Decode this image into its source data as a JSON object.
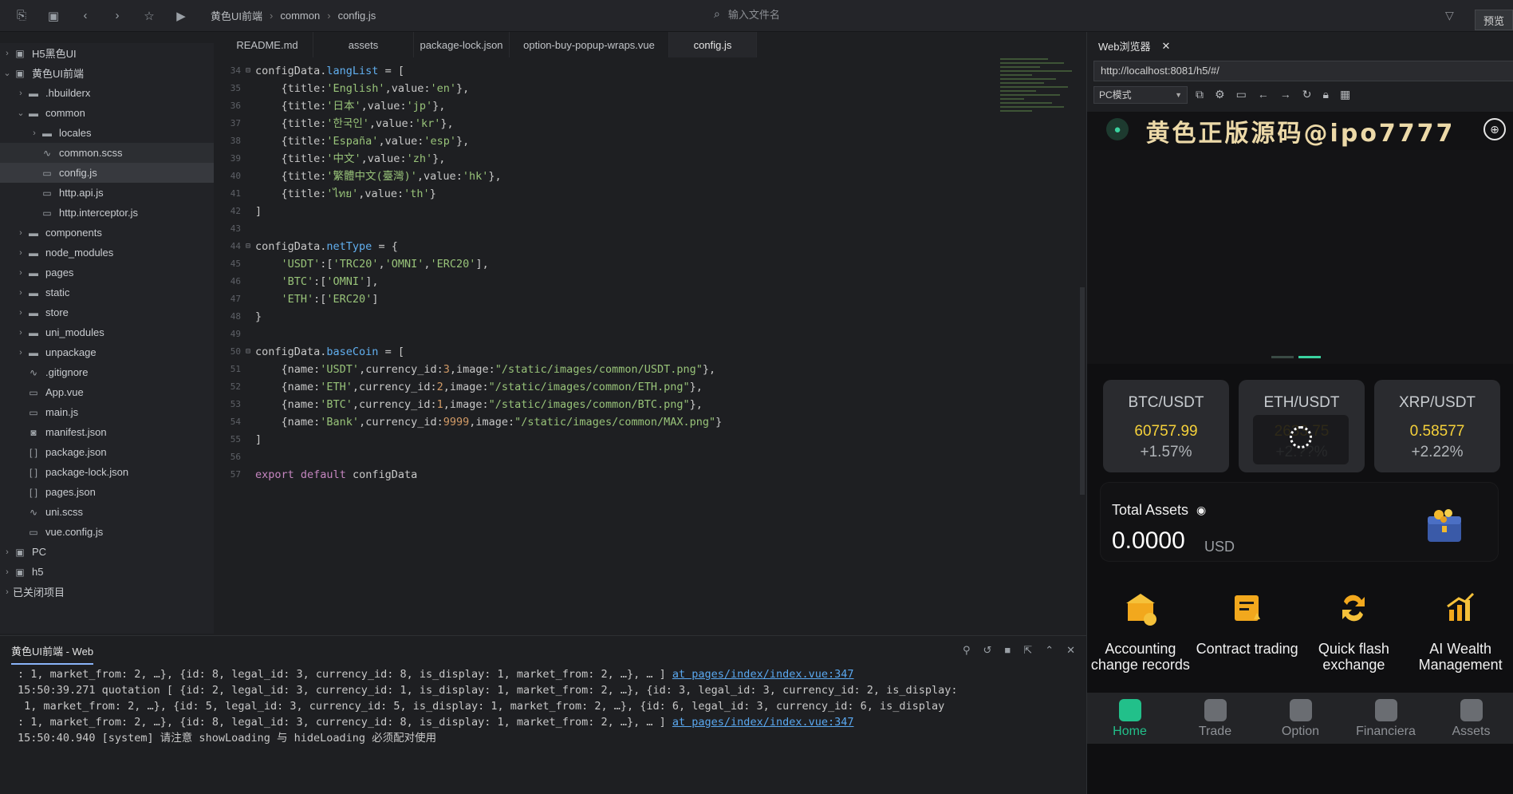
{
  "toolbar": {
    "breadcrumb": [
      "黄色UI前端",
      "common",
      "config.js"
    ],
    "file_search_placeholder": "输入文件名",
    "preview_label": "预览"
  },
  "sidebar": {
    "items": [
      {
        "label": "H5黑色UI",
        "depth": 0,
        "type": "project",
        "expanded": false
      },
      {
        "label": "黄色UI前端",
        "depth": 0,
        "type": "project",
        "expanded": true
      },
      {
        "label": ".hbuilderx",
        "depth": 1,
        "type": "folder",
        "expanded": false
      },
      {
        "label": "common",
        "depth": 1,
        "type": "folder",
        "expanded": true
      },
      {
        "label": "locales",
        "depth": 2,
        "type": "folder",
        "expanded": false
      },
      {
        "label": "common.scss",
        "depth": 2,
        "type": "style"
      },
      {
        "label": "config.js",
        "depth": 2,
        "type": "file"
      },
      {
        "label": "http.api.js",
        "depth": 2,
        "type": "file"
      },
      {
        "label": "http.interceptor.js",
        "depth": 2,
        "type": "file"
      },
      {
        "label": "components",
        "depth": 1,
        "type": "folder",
        "expanded": false
      },
      {
        "label": "node_modules",
        "depth": 1,
        "type": "folder",
        "expanded": false
      },
      {
        "label": "pages",
        "depth": 1,
        "type": "folder",
        "expanded": false
      },
      {
        "label": "static",
        "depth": 1,
        "type": "folder",
        "expanded": false
      },
      {
        "label": "store",
        "depth": 1,
        "type": "folder",
        "expanded": false
      },
      {
        "label": "uni_modules",
        "depth": 1,
        "type": "folder",
        "expanded": false
      },
      {
        "label": "unpackage",
        "depth": 1,
        "type": "folder",
        "expanded": false
      },
      {
        "label": ".gitignore",
        "depth": 1,
        "type": "style"
      },
      {
        "label": "App.vue",
        "depth": 1,
        "type": "file"
      },
      {
        "label": "main.js",
        "depth": 1,
        "type": "file"
      },
      {
        "label": "manifest.json",
        "depth": 1,
        "type": "manifest"
      },
      {
        "label": "package.json",
        "depth": 1,
        "type": "json"
      },
      {
        "label": "package-lock.json",
        "depth": 1,
        "type": "json"
      },
      {
        "label": "pages.json",
        "depth": 1,
        "type": "json"
      },
      {
        "label": "uni.scss",
        "depth": 1,
        "type": "style"
      },
      {
        "label": "vue.config.js",
        "depth": 1,
        "type": "file"
      },
      {
        "label": "PC",
        "depth": 0,
        "type": "project",
        "expanded": false
      },
      {
        "label": "h5",
        "depth": 0,
        "type": "project",
        "expanded": false
      },
      {
        "label": "已关闭项目",
        "depth": 0,
        "type": "group",
        "expanded": false
      }
    ]
  },
  "editor": {
    "tabs": [
      {
        "label": "README.md",
        "active": false
      },
      {
        "label": "assets",
        "active": false
      },
      {
        "label": "package-lock.json",
        "active": false
      },
      {
        "label": "option-buy-popup-wraps.vue",
        "active": false
      },
      {
        "label": "config.js",
        "active": true
      }
    ],
    "lines": [
      {
        "n": "34",
        "text": "configData.langList = [",
        "fold": true
      },
      {
        "n": "35",
        "text": "    {title:'English',value:'en'},"
      },
      {
        "n": "36",
        "text": "    {title:'日本',value:'jp'},"
      },
      {
        "n": "37",
        "text": "    {title:'한국인',value:'kr'},"
      },
      {
        "n": "38",
        "text": "    {title:'España',value:'esp'},"
      },
      {
        "n": "39",
        "text": "    {title:'中文',value:'zh'},"
      },
      {
        "n": "40",
        "text": "    {title:'繁體中文(臺灣)',value:'hk'},"
      },
      {
        "n": "41",
        "text": "    {title:'ไทย',value:'th'}"
      },
      {
        "n": "42",
        "text": "]"
      },
      {
        "n": "43",
        "text": ""
      },
      {
        "n": "44",
        "text": "configData.netType = {",
        "fold": true
      },
      {
        "n": "45",
        "text": "    'USDT':['TRC20','OMNI','ERC20'],"
      },
      {
        "n": "46",
        "text": "    'BTC':['OMNI'],"
      },
      {
        "n": "47",
        "text": "    'ETH':['ERC20']"
      },
      {
        "n": "48",
        "text": "}"
      },
      {
        "n": "49",
        "text": ""
      },
      {
        "n": "50",
        "text": "configData.baseCoin = [",
        "fold": true
      },
      {
        "n": "51",
        "text": "    {name:'USDT',currency_id:3,image:\"/static/images/common/USDT.png\"},"
      },
      {
        "n": "52",
        "text": "    {name:'ETH',currency_id:2,image:\"/static/images/common/ETH.png\"},"
      },
      {
        "n": "53",
        "text": "    {name:'BTC',currency_id:1,image:\"/static/images/common/BTC.png\"},"
      },
      {
        "n": "54",
        "text": "    {name:'Bank',currency_id:9999,image:\"/static/images/common/MAX.png\"}"
      },
      {
        "n": "55",
        "text": "]"
      },
      {
        "n": "56",
        "text": ""
      },
      {
        "n": "57",
        "text": "export default configData"
      }
    ]
  },
  "console": {
    "title": "黄色UI前端 - Web",
    "lines": [
      {
        "text": ": 1, market_from: 2, …}, {id: 8, legal_id: 3, currency_id: 8, is_display: 1, market_from: 2, …}, … ] ",
        "link": "at pages/index/index.vue:347"
      },
      {
        "text": "15:50:39.271 quotation [ {id: 2, legal_id: 3, currency_id: 1, is_display: 1, market_from: 2, …}, {id: 3, legal_id: 3, currency_id: 2, is_display:",
        "link": ""
      },
      {
        "text": " 1, market_from: 2, …}, {id: 5, legal_id: 3, currency_id: 5, is_display: 1, market_from: 2, …}, {id: 6, legal_id: 3, currency_id: 6, is_display",
        "link": ""
      },
      {
        "text": ": 1, market_from: 2, …}, {id: 8, legal_id: 3, currency_id: 8, is_display: 1, market_from: 2, …}, … ] ",
        "link": "at pages/index/index.vue:347"
      },
      {
        "text": "15:50:40.940 [system] 请注意 showLoading 与 hideLoading 必须配对使用",
        "link": ""
      }
    ]
  },
  "browser": {
    "tab_label": "Web浏览器",
    "url": "http://localhost:8081/h5/#/",
    "mode": "PC模式"
  },
  "app": {
    "title": "黄色正版源码@ipo7777",
    "tickers": [
      {
        "pair": "BTC/USDT",
        "price": "60757.99",
        "change": "+1.57%",
        "loading": false
      },
      {
        "pair": "ETH/USDT",
        "price": "2633.75",
        "change": "+2.??%",
        "loading": true
      },
      {
        "pair": "XRP/USDT",
        "price": "0.58577",
        "change": "+2.22%",
        "loading": false
      }
    ],
    "assets": {
      "title": "Total Assets",
      "value": "0.0000",
      "unit": "USD"
    },
    "features": [
      {
        "label": "Accounting change records",
        "icon": "bank-icon"
      },
      {
        "label": "Contract trading",
        "icon": "contract-icon"
      },
      {
        "label": "Quick flash exchange",
        "icon": "exchange-icon"
      },
      {
        "label": "AI Wealth Management",
        "icon": "wealth-icon"
      }
    ],
    "tabbar": [
      {
        "label": "Home",
        "active": true
      },
      {
        "label": "Trade",
        "active": false
      },
      {
        "label": "Option",
        "active": false
      },
      {
        "label": "Financiera",
        "active": false
      },
      {
        "label": "Assets",
        "active": false
      }
    ],
    "accent_color": "#22c08a",
    "price_color": "#f5d13a"
  }
}
